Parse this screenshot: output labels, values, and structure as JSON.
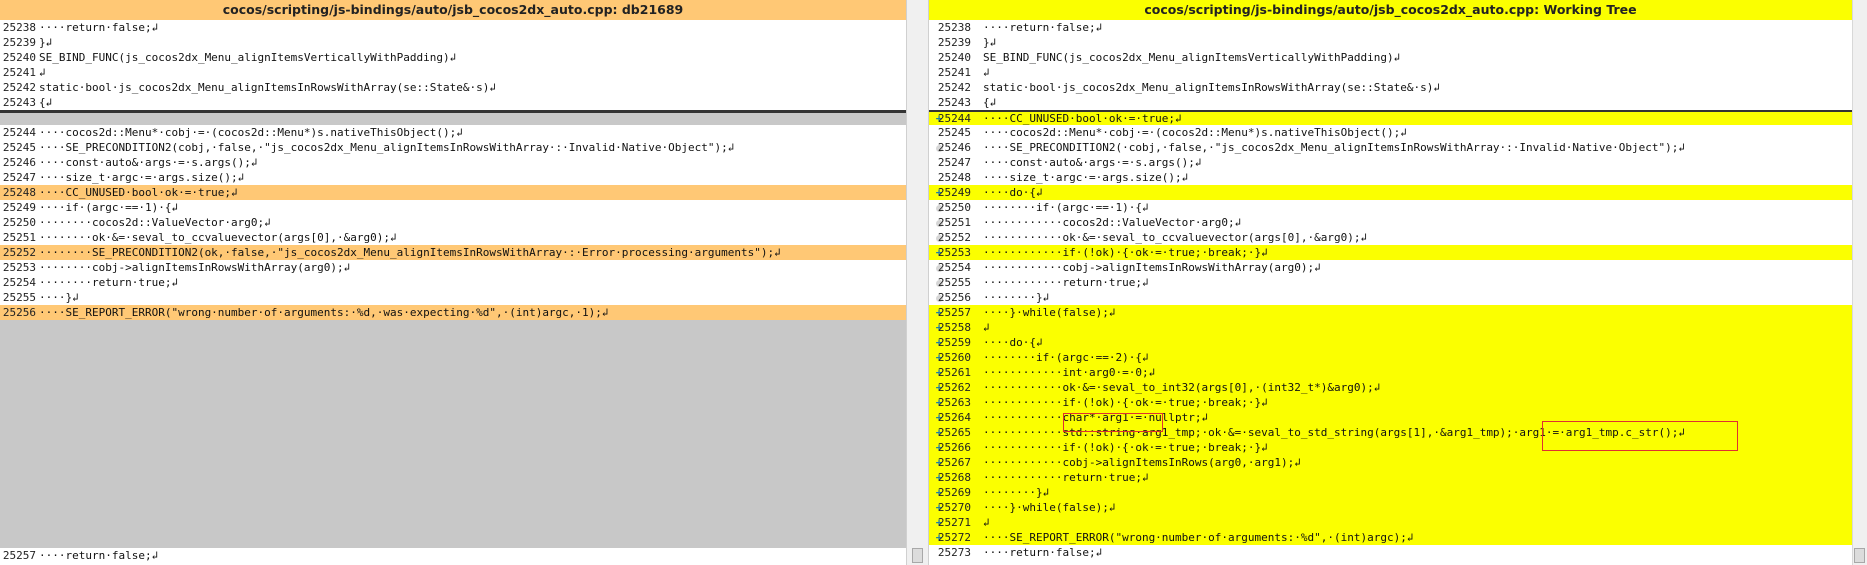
{
  "left_pane": {
    "title": "cocos/scripting/js-bindings/auto/jsb_cocos2dx_auto.cpp: db21689",
    "lines": [
      {
        "num": "25238",
        "text": "····return·false;↲",
        "type": "normal"
      },
      {
        "num": "25239",
        "text": "}↲",
        "type": "normal"
      },
      {
        "num": "25240",
        "text": "SE_BIND_FUNC(js_cocos2dx_Menu_alignItemsVerticallyWithPadding)↲",
        "type": "normal"
      },
      {
        "num": "25241",
        "text": "↲",
        "type": "normal"
      },
      {
        "num": "25242",
        "text": "static·bool·js_cocos2dx_Menu_alignItemsInRowsWithArray(se::State&·s)↲",
        "type": "normal"
      },
      {
        "num": "25243",
        "text": "{↲",
        "type": "normal"
      },
      {
        "num": "",
        "text": "",
        "type": "empty"
      },
      {
        "num": "25244",
        "text": "····cocos2d::Menu*·cobj·=·(cocos2d::Menu*)s.nativeThisObject();↲",
        "type": "normal"
      },
      {
        "num": "25245",
        "text": "····SE_PRECONDITION2(cobj,·false,·\"js_cocos2dx_Menu_alignItemsInRowsWithArray·:·Invalid·Native·Object\");↲",
        "type": "normal"
      },
      {
        "num": "25246",
        "text": "····const·auto&·args·=·s.args();↲",
        "type": "normal"
      },
      {
        "num": "25247",
        "text": "····size_t·argc·=·args.size();↲",
        "type": "normal"
      },
      {
        "num": "25248",
        "text": "····CC_UNUSED·bool·ok·=·true;↲",
        "type": "mod"
      },
      {
        "num": "25249",
        "text": "····if·(argc·==·1)·{↲",
        "type": "normal"
      },
      {
        "num": "25250",
        "text": "········cocos2d::ValueVector·arg0;↲",
        "type": "normal"
      },
      {
        "num": "25251",
        "text": "········ok·&=·seval_to_ccvaluevector(args[0],·&arg0);↲",
        "type": "normal"
      },
      {
        "num": "25252",
        "text": "········SE_PRECONDITION2(ok,·false,·\"js_cocos2dx_Menu_alignItemsInRowsWithArray·:·Error·processing·arguments\");↲",
        "type": "mod"
      },
      {
        "num": "25253",
        "text": "········cobj->alignItemsInRowsWithArray(arg0);↲",
        "type": "normal"
      },
      {
        "num": "25254",
        "text": "········return·true;↲",
        "type": "normal"
      },
      {
        "num": "25255",
        "text": "····}↲",
        "type": "normal"
      },
      {
        "num": "25256",
        "text": "····SE_REPORT_ERROR(\"wrong·number·of·arguments:·%d,·was·expecting·%d\",·(int)argc,·1);↲",
        "type": "mod"
      }
    ],
    "bottom_line": {
      "num": "25257",
      "text": "····return·false;↲"
    }
  },
  "right_pane": {
    "title": "cocos/scripting/js-bindings/auto/jsb_cocos2dx_auto.cpp: Working Tree",
    "lines": [
      {
        "num": "25238",
        "text": "····return·false;↲",
        "type": "normal",
        "marker": ""
      },
      {
        "num": "25239",
        "text": "}↲",
        "type": "normal",
        "marker": ""
      },
      {
        "num": "25240",
        "text": "SE_BIND_FUNC(js_cocos2dx_Menu_alignItemsVerticallyWithPadding)↲",
        "type": "normal",
        "marker": ""
      },
      {
        "num": "25241",
        "text": "↲",
        "type": "normal",
        "marker": ""
      },
      {
        "num": "25242",
        "text": "static·bool·js_cocos2dx_Menu_alignItemsInRowsWithArray(se::State&·s)↲",
        "type": "normal",
        "marker": ""
      },
      {
        "num": "25243",
        "text": "{↲",
        "type": "normal",
        "marker": ""
      },
      {
        "num": "25244",
        "text": "····CC_UNUSED·bool·ok·=·true;↲",
        "type": "add",
        "marker": "plus"
      },
      {
        "num": "25245",
        "text": "····cocos2d::Menu*·cobj·=·(cocos2d::Menu*)s.nativeThisObject();↲",
        "type": "normal",
        "marker": ""
      },
      {
        "num": "25246",
        "text": "····SE_PRECONDITION2(·cobj,·false,·\"js_cocos2dx_Menu_alignItemsInRowsWithArray·:·Invalid·Native·Object\");↲",
        "type": "normal",
        "marker": "dot"
      },
      {
        "num": "25247",
        "text": "····const·auto&·args·=·s.args();↲",
        "type": "normal",
        "marker": ""
      },
      {
        "num": "25248",
        "text": "····size_t·argc·=·args.size();↲",
        "type": "normal",
        "marker": ""
      },
      {
        "num": "25249",
        "text": "····do·{↲",
        "type": "add",
        "marker": "plus"
      },
      {
        "num": "25250",
        "text": "········if·(argc·==·1)·{↲",
        "type": "normal",
        "marker": "dot"
      },
      {
        "num": "25251",
        "text": "············cocos2d::ValueVector·arg0;↲",
        "type": "normal",
        "marker": "dot"
      },
      {
        "num": "25252",
        "text": "············ok·&=·seval_to_ccvaluevector(args[0],·&arg0);↲",
        "type": "normal",
        "marker": "dot"
      },
      {
        "num": "25253",
        "text": "············if·(!ok)·{·ok·=·true;·break;·}↲",
        "type": "add",
        "marker": "plus"
      },
      {
        "num": "25254",
        "text": "············cobj->alignItemsInRowsWithArray(arg0);↲",
        "type": "normal",
        "marker": "dot"
      },
      {
        "num": "25255",
        "text": "············return·true;↲",
        "type": "normal",
        "marker": "dot"
      },
      {
        "num": "25256",
        "text": "········}↲",
        "type": "normal",
        "marker": "dot"
      },
      {
        "num": "25257",
        "text": "····}·while(false);↲",
        "type": "add",
        "marker": "plus"
      },
      {
        "num": "25258",
        "text": "↲",
        "type": "add",
        "marker": "plus"
      },
      {
        "num": "25259",
        "text": "····do·{↲",
        "type": "add",
        "marker": "plus"
      },
      {
        "num": "25260",
        "text": "········if·(argc·==·2)·{↲",
        "type": "add",
        "marker": "plus"
      },
      {
        "num": "25261",
        "text": "············int·arg0·=·0;↲",
        "type": "add",
        "marker": "plus"
      },
      {
        "num": "25262",
        "text": "············ok·&=·seval_to_int32(args[0],·(int32_t*)&arg0);↲",
        "type": "add",
        "marker": "plus"
      },
      {
        "num": "25263",
        "text": "············if·(!ok)·{·ok·=·true;·break;·}↲",
        "type": "add",
        "marker": "plus"
      },
      {
        "num": "25264",
        "text": "············char*·arg1·=·nullptr;↲",
        "type": "add",
        "marker": "plus"
      },
      {
        "num": "25265",
        "text": "············std::string·arg1_tmp;·ok·&=·seval_to_std_string(args[1],·&arg1_tmp);·arg1·=·arg1_tmp.c_str();↲",
        "type": "add",
        "marker": "plus"
      },
      {
        "num": "25266",
        "text": "············if·(!ok)·{·ok·=·true;·break;·}↲",
        "type": "add",
        "marker": "plus"
      },
      {
        "num": "25267",
        "text": "············cobj->alignItemsInRows(arg0,·arg1);↲",
        "type": "add",
        "marker": "plus"
      },
      {
        "num": "25268",
        "text": "············return·true;↲",
        "type": "add",
        "marker": "plus"
      },
      {
        "num": "25269",
        "text": "········}↲",
        "type": "add",
        "marker": "plus"
      },
      {
        "num": "25270",
        "text": "····}·while(false);↲",
        "type": "add",
        "marker": "plus"
      },
      {
        "num": "25271",
        "text": "↲",
        "type": "add",
        "marker": "plus"
      },
      {
        "num": "25272",
        "text": "····SE_REPORT_ERROR(\"wrong·number·of·arguments:·%d\",·(int)argc);↲",
        "type": "add",
        "marker": "plus"
      },
      {
        "num": "25273",
        "text": "····return·false;↲",
        "type": "normal",
        "marker": ""
      }
    ]
  }
}
